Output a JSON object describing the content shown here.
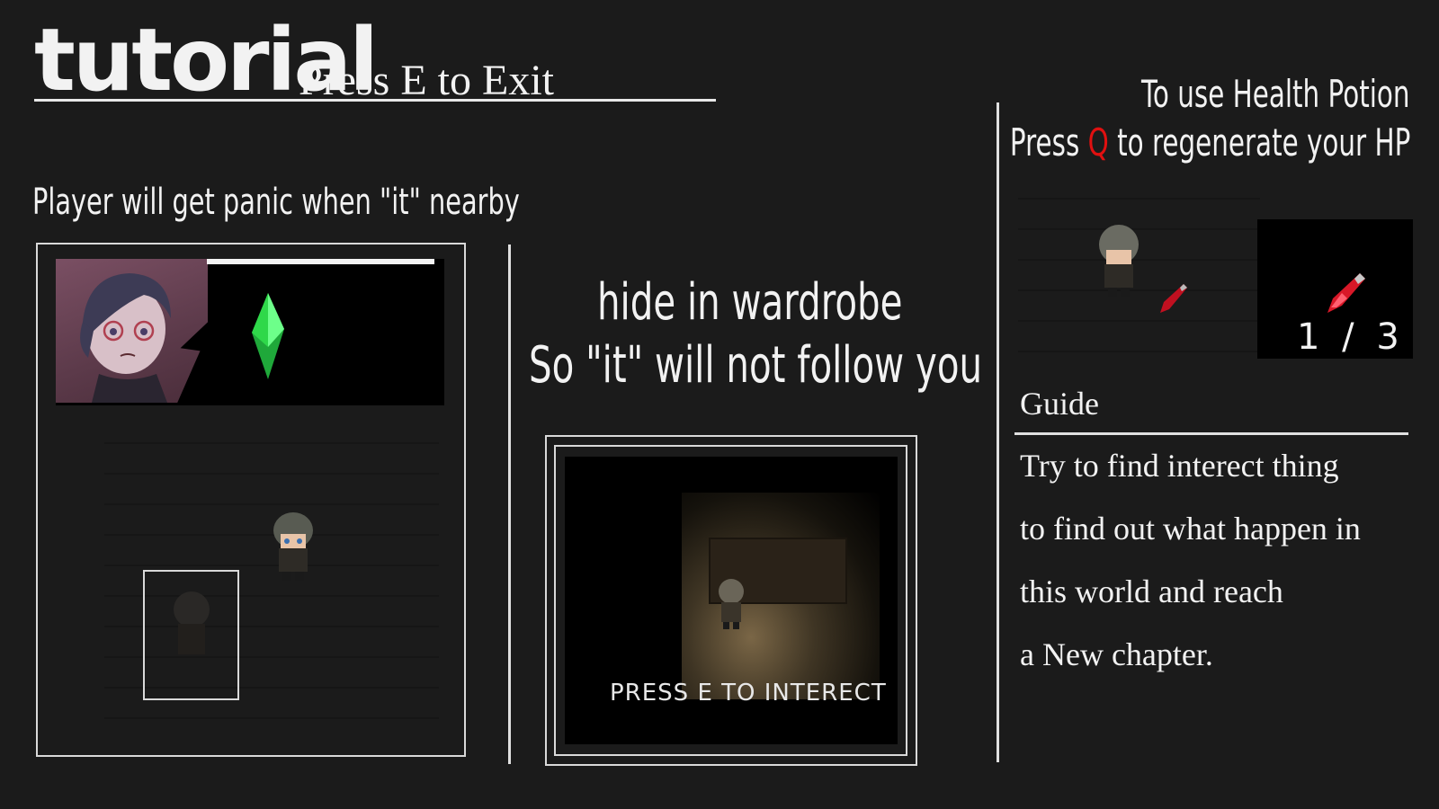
{
  "header": {
    "title": "tutorial",
    "exit_hint": "Press E to Exit"
  },
  "left_panel": {
    "caption": "Player will get panic when \"it\" nearby",
    "hp_bar_fill": 1.0
  },
  "middle_panel": {
    "line1": "hide in wardrobe",
    "line2": "So \"it\" will not follow you",
    "interact_prompt": "PRESS E TO INTERECT"
  },
  "right_panel": {
    "potion_line1": "To use Health Potion",
    "potion_line2_prefix": "Press ",
    "potion_key": "Q",
    "potion_line2_suffix": " to regenerate your HP",
    "potion_count": "1  / 3",
    "guide_label": "Guide",
    "guide_lines": [
      "Try to find interect thing",
      "to find out what happen in",
      "this world and reach",
      "a New chapter."
    ]
  },
  "icons": {
    "crystal": "green-crystal-icon",
    "potion": "red-potion-icon"
  },
  "colors": {
    "background": "#1b1b1b",
    "key_highlight": "#e01010",
    "crystal": "#2fd84a"
  }
}
